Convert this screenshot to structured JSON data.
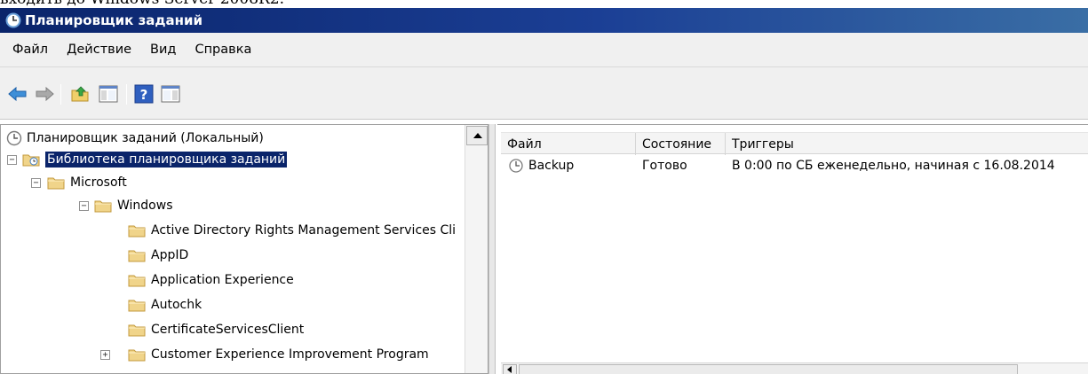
{
  "caption": "входить до Windows Server 2008R2.",
  "window": {
    "title": "Планировщик заданий"
  },
  "menu": [
    "Файл",
    "Действие",
    "Вид",
    "Справка"
  ],
  "toolbar": {
    "buttons": [
      "back-arrow-icon",
      "forward-arrow-icon",
      "up-folder-icon",
      "show-hide-console-tree-icon",
      "help-icon",
      "show-hide-action-pane-icon"
    ]
  },
  "tree": {
    "items": [
      {
        "label": "Планировщик заданий (Локальный)"
      },
      {
        "label": "Библиотека планировщика заданий",
        "expander": "⊟"
      },
      {
        "label": "Microsoft",
        "expander": "⊟"
      },
      {
        "label": "Windows",
        "expander": "⊟"
      },
      {
        "label": "Active Directory Rights Management Services Cli"
      },
      {
        "label": "AppID"
      },
      {
        "label": "Application Experience"
      },
      {
        "label": "Autochk"
      },
      {
        "label": "CertificateServicesClient"
      },
      {
        "label": "Customer Experience Improvement Program",
        "expander": "⊞"
      }
    ]
  },
  "list": {
    "columns": [
      "Файл",
      "Состояние",
      "Триггеры"
    ],
    "rows": [
      {
        "name": "Backup",
        "status": "Готово",
        "trigger": "В 0:00 по СБ еженедельно, начиная с 16.08.2014"
      }
    ]
  },
  "colors": {
    "title_bar": "#0a246a",
    "selection": "#0a246a",
    "folder": "#f0d48a"
  }
}
